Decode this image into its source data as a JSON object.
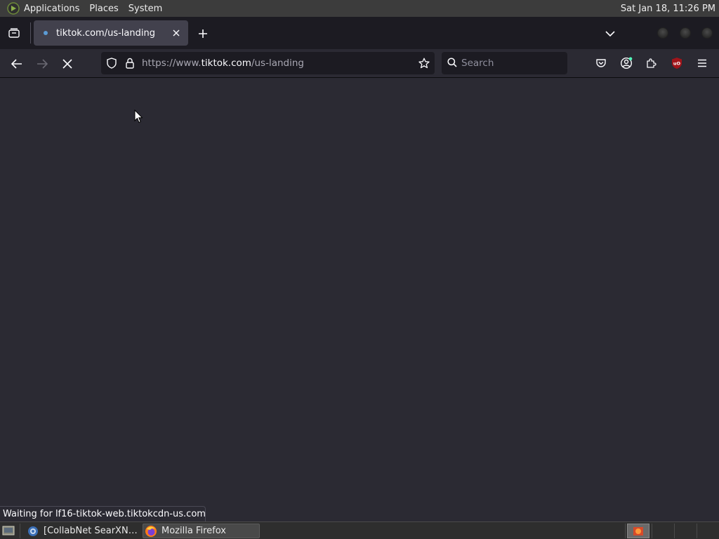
{
  "top_panel": {
    "menus": [
      "Applications",
      "Places",
      "System"
    ],
    "clock": "Sat Jan 18, 11:26 PM"
  },
  "browser": {
    "tab": {
      "title": "tiktok.com/us-landing"
    },
    "url": {
      "prefix": "https://www.",
      "host": "tiktok.com",
      "path": "/us-landing"
    },
    "search_placeholder": "Search",
    "status_text": "Waiting for lf16-tiktok-web.tiktokcdn-us.com…"
  },
  "taskbar": {
    "tasks": [
      {
        "label": "[CollabNet SearXN…",
        "icon": "browser-globe-icon"
      },
      {
        "label": "Mozilla Firefox",
        "icon": "firefox-icon"
      }
    ]
  },
  "colors": {
    "content_bg": "#2b2a33",
    "tabstrip_bg": "#1c1b22",
    "urlbar_bg": "#1c1b22",
    "active_tab_bg": "#42414d",
    "ublock_red": "#a1141a"
  }
}
